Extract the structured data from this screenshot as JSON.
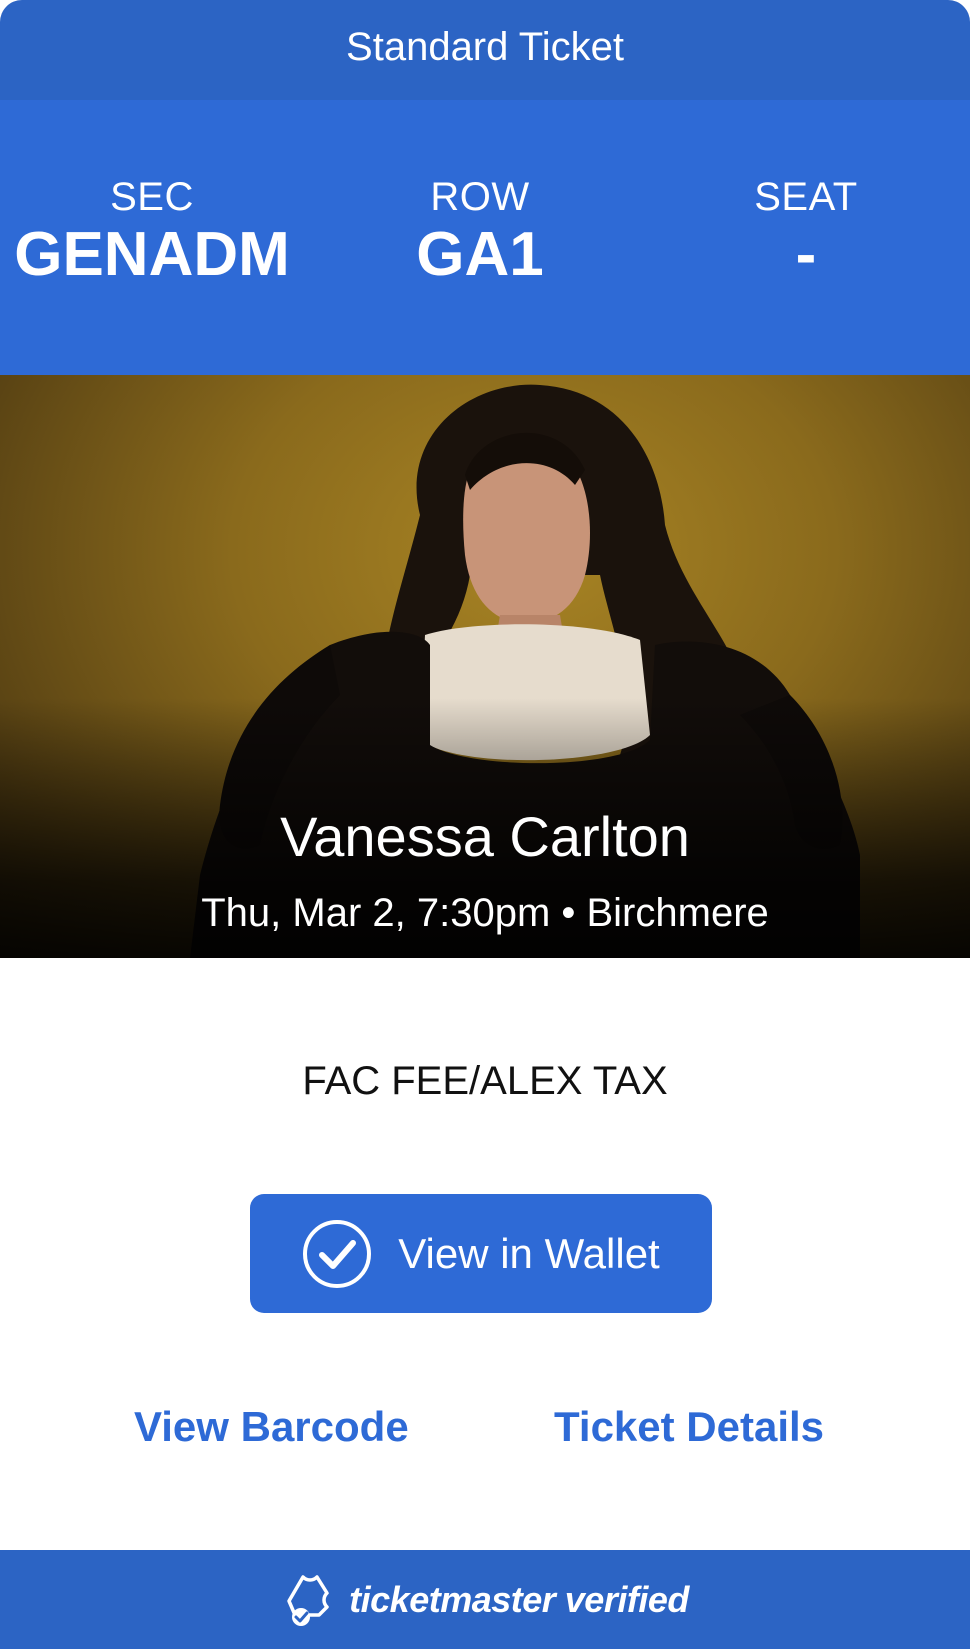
{
  "header": {
    "title": "Standard Ticket"
  },
  "seating": {
    "sec_label": "SEC",
    "sec_value": "GENADM",
    "row_label": "ROW",
    "row_value": "GA1",
    "seat_label": "SEAT",
    "seat_value": "-"
  },
  "event": {
    "name": "Vanessa Carlton",
    "meta": "Thu, Mar 2, 7:30pm • Birchmere"
  },
  "fee_note": "FAC FEE/ALEX TAX",
  "actions": {
    "wallet_label": "View in Wallet",
    "barcode_label": "View Barcode",
    "details_label": "Ticket Details"
  },
  "footer": {
    "brand": "ticketmaster verified"
  },
  "colors": {
    "primary": "#2e6ad6",
    "header": "#2c64c4",
    "text": "#111111"
  },
  "icons": {
    "wallet": "checkmark-circle-icon",
    "footer": "ticketmaster-ticket-check-icon"
  }
}
